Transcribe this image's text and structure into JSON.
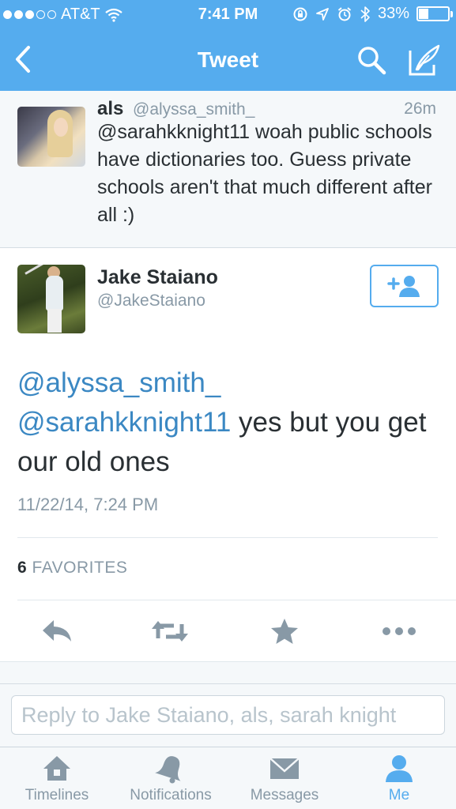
{
  "status_bar": {
    "carrier": "AT&T",
    "time": "7:41 PM",
    "battery": "33%",
    "battery_level": 0.33
  },
  "nav": {
    "title": "Tweet"
  },
  "reply_context": {
    "name": "als",
    "handle": "@alyssa_smith_",
    "time": "26m",
    "text": "@sarahkknight11 woah public schools have dictionaries too. Guess private schools aren't that much different after all :)"
  },
  "tweet": {
    "name": "Jake Staiano",
    "handle": "@JakeStaiano",
    "mention1": "@alyssa_smith_",
    "mention2": "@sarahkknight11",
    "text_rest": " yes but you get our old ones",
    "timestamp": "11/22/14, 7:24 PM",
    "favorites_count": "6",
    "favorites_label": "FAVORITES"
  },
  "reply_box": {
    "placeholder": "Reply to Jake Staiano, als, sarah knight"
  },
  "tabs": [
    {
      "label": "Timelines",
      "icon": "home-icon",
      "active": false
    },
    {
      "label": "Notifications",
      "icon": "bell-icon",
      "active": false
    },
    {
      "label": "Messages",
      "icon": "envelope-icon",
      "active": false
    },
    {
      "label": "Me",
      "icon": "person-icon",
      "active": true
    }
  ],
  "colors": {
    "brand": "#55acee",
    "link": "#3b88c3",
    "muted": "#8899a6",
    "text": "#292f33"
  }
}
